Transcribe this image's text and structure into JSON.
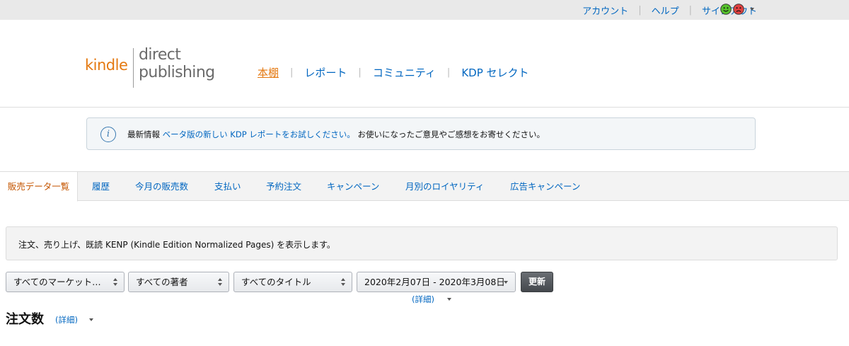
{
  "top_links": [
    "アカウント",
    "ヘルプ",
    "サインアウト"
  ],
  "logo": {
    "kindle": "kindle",
    "direct": "direct",
    "publishing": "publishing"
  },
  "main_nav": [
    "本棚",
    "レポート",
    "コミュニティ",
    "KDP セレクト"
  ],
  "notice": {
    "label": "最新情報",
    "link": "ベータ版の新しい KDP レポートをお試しください。",
    "text": "お使いになったご意見やご感想をお寄せください。"
  },
  "tabs": [
    "販売データ一覧",
    "履歴",
    "今月の販売数",
    "支払い",
    "予約注文",
    "キャンペーン",
    "月別のロイヤリティ",
    "広告キャンペーン"
  ],
  "description": "注文、売り上げ、既読 KENP (Kindle Edition Normalized Pages) を表示します。",
  "filters": {
    "marketplace": "すべてのマーケット…",
    "author": "すべての著者",
    "title": "すべてのタイトル",
    "date_range": "2020年2月07日 - 2020年3月08日",
    "update_label": "更新",
    "details_label": "(詳細)"
  },
  "orders": {
    "heading": "注文数",
    "details_label": "(詳細)"
  },
  "colors": {
    "link": "#0066c0",
    "accent": "#e47911",
    "active_tab": "#c45500"
  }
}
